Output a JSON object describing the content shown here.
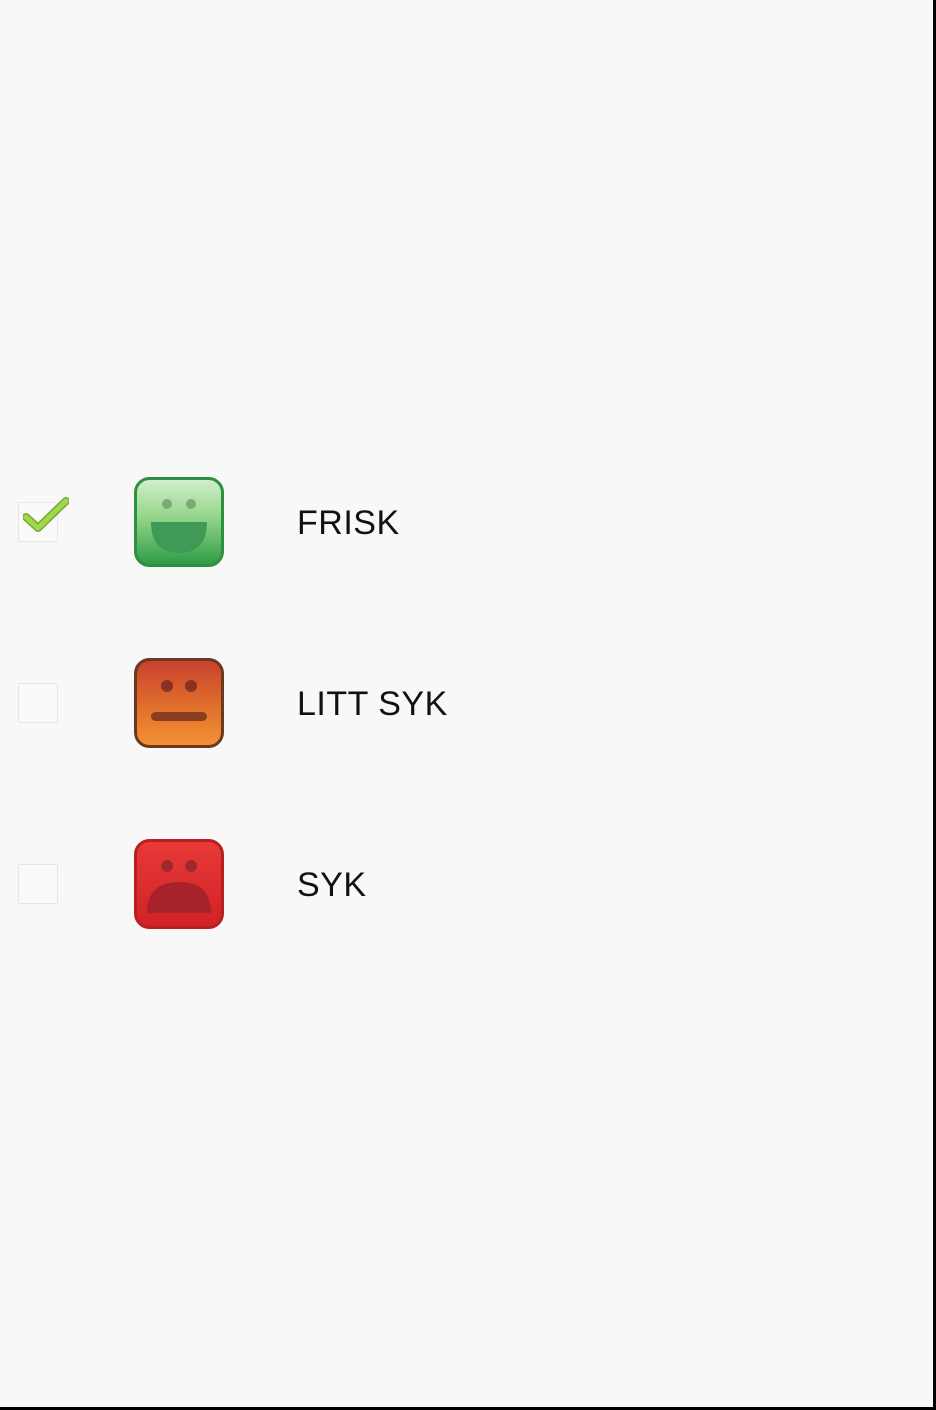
{
  "options": [
    {
      "label": "FRISK",
      "icon": "happy-face-icon",
      "checked": true,
      "colors": {
        "top": "#c3e8ba",
        "bottom": "#2f9a45",
        "border": "#2d9040"
      }
    },
    {
      "label": "LITT SYK",
      "icon": "neutral-face-icon",
      "checked": false,
      "colors": {
        "top": "#c8452f",
        "bottom": "#f08a30",
        "border": "#6a3a20"
      }
    },
    {
      "label": "SYK",
      "icon": "sad-face-icon",
      "checked": false,
      "colors": {
        "top": "#e33232",
        "bottom": "#b8222a",
        "border": "#b82020"
      }
    }
  ],
  "check_color": "#8bc63e"
}
